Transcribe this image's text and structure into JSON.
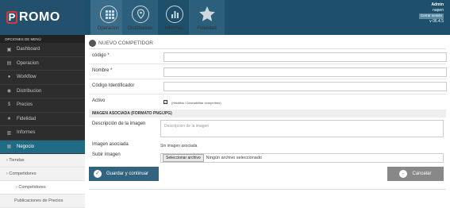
{
  "brand": {
    "logo_letter": "P",
    "logo_text": "ROMO"
  },
  "top_nav": [
    {
      "label": "Operacion",
      "icon": "grid-icon"
    },
    {
      "label": "Distribucion",
      "icon": "map-pin-icon"
    },
    {
      "label": "Informes",
      "icon": "bar-chart-icon"
    },
    {
      "label": "Fidelidad",
      "icon": "star-icon"
    }
  ],
  "user": {
    "name": "Admin",
    "username": "napen",
    "logout": "Cerrar sesión",
    "version": "v 06.4.5"
  },
  "sidebar": {
    "header": "Opciones de menú",
    "items": [
      {
        "label": "Dashboard",
        "icon": "▣"
      },
      {
        "label": "Operacion",
        "icon": "▤"
      },
      {
        "label": "Workflow",
        "icon": "●"
      },
      {
        "label": "Distribucion",
        "icon": "◉"
      },
      {
        "label": "Precios",
        "icon": "$"
      },
      {
        "label": "Fidelidad",
        "icon": "★"
      },
      {
        "label": "Informes",
        "icon": "▥"
      },
      {
        "label": "Negocio",
        "icon": "▦"
      }
    ],
    "sub": [
      {
        "label": "› Tiendas"
      },
      {
        "label": "› Competidores"
      },
      {
        "label": "› Competidores"
      },
      {
        "label": "Publicaciones de Precios"
      }
    ]
  },
  "form": {
    "title": "NUEVO COMPETIDOR",
    "codigo_label": "código *",
    "nombre_label": "Nombre *",
    "codigo_identificador_label": "Código Identificador",
    "activo_label": "Activo",
    "activo_help": "(Habilitar / Deshabilitar competidor)",
    "section_image": "IMAGEN ASOCIADA (FORMATO PNG/JPG)",
    "descripcion_label": "Descripción de la imagen",
    "descripcion_placeholder": "Descripcion de la imagen",
    "imagen_asociada_label": "Imagen asociada",
    "imagen_asociada_value": "Sin imagen asociada",
    "subir_label": "Subir Imagen",
    "file_button": "Seleccionar archivo",
    "file_status": "Ningún archivo seleccionado",
    "save_label": "Guardar y continuar",
    "cancel_label": "Cancelar"
  },
  "colors": {
    "topbar": "#1e4f6b",
    "accent": "#1f6b86",
    "danger": "#d9363e"
  }
}
